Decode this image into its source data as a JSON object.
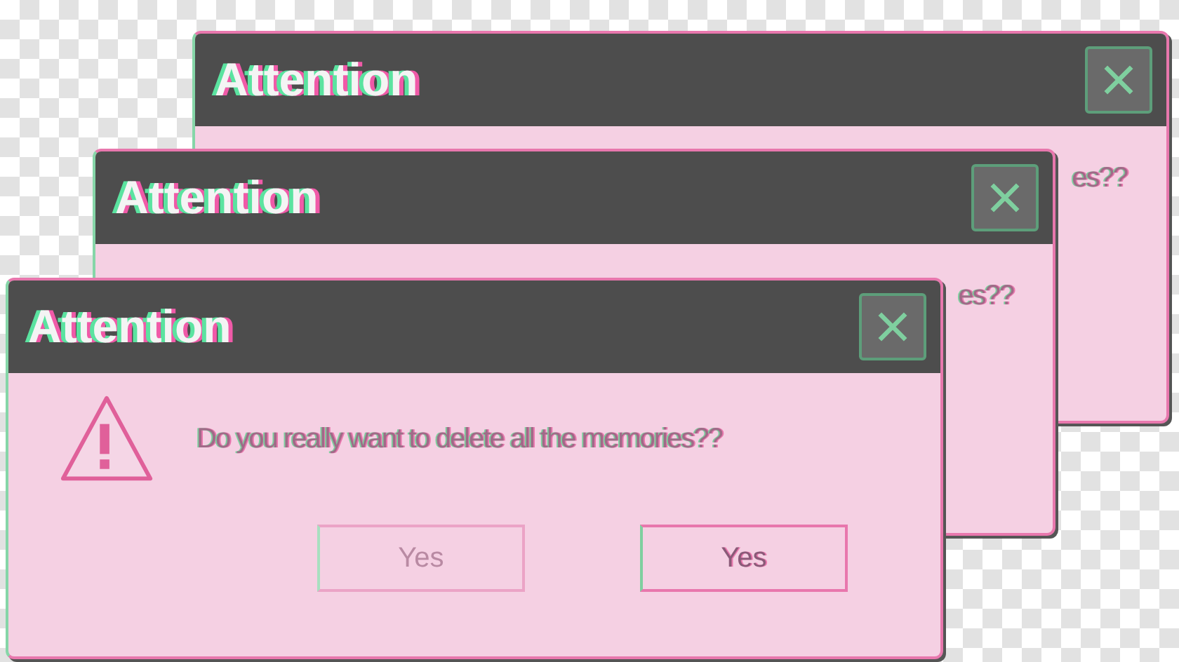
{
  "windows": [
    {
      "title": "Attention",
      "message": "es??"
    },
    {
      "title": "Attention",
      "message": "es??"
    },
    {
      "title": "Attention",
      "message": "Do you really want to delete all the memories??",
      "buttons": [
        {
          "label": "Yes",
          "disabled": true
        },
        {
          "label": "Yes",
          "disabled": false
        }
      ]
    }
  ]
}
